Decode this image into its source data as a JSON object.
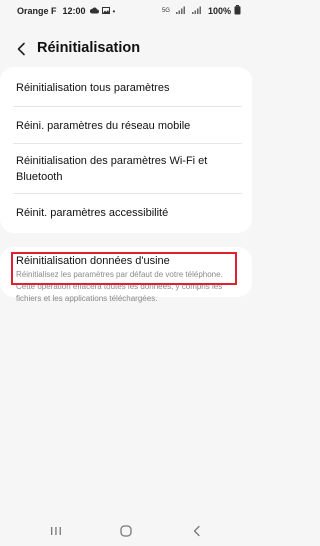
{
  "status_bar": {
    "carrier": "Orange F",
    "time": "12:00",
    "network": "5G",
    "battery": "100%"
  },
  "header": {
    "title": "Réinitialisation"
  },
  "menu": {
    "items": [
      {
        "label": "Réinitialisation tous paramètres"
      },
      {
        "label": "Réini. paramètres du réseau mobile"
      },
      {
        "label": "Réinitialisation des paramètres Wi-Fi et Bluetooth"
      },
      {
        "label": "Réinit. paramètres accessibilité"
      }
    ]
  },
  "factory_reset": {
    "title": "Réinitialisation données d'usine",
    "description": "Réinitialisez les paramètres par défaut de votre téléphone. Cette opération effacera toutes les données, y compris les fichiers et les applications téléchargées."
  },
  "nav": {
    "buttons": [
      "recent-apps",
      "home",
      "back"
    ]
  }
}
